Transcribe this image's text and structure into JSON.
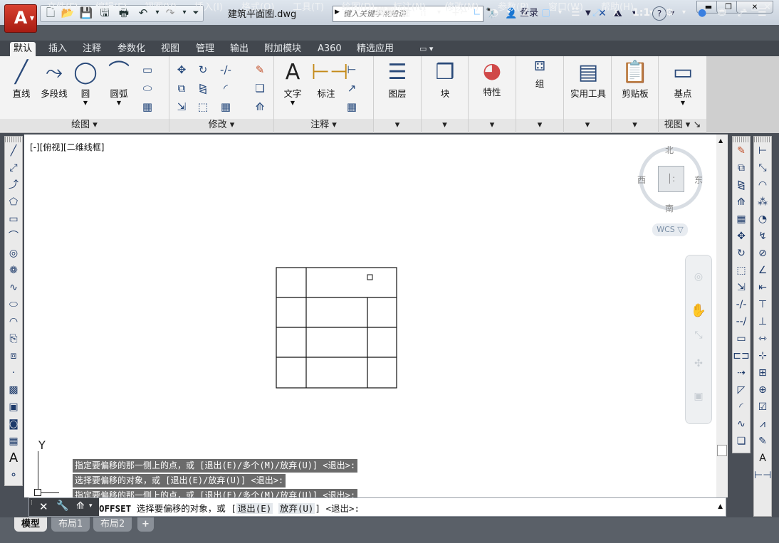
{
  "app": {
    "logo": "A",
    "doc_title": "建筑平面图.dwg",
    "login": "登录"
  },
  "search": {
    "placeholder": "键入关键字或短语"
  },
  "menus": [
    "文件(F)",
    "编辑(E)",
    "视图(V)",
    "插入(I)",
    "格式(O)",
    "工具(T)",
    "绘图(D)",
    "标注(N)",
    "修改(M)",
    "参数(P)",
    "窗口(W)",
    "帮助(H)"
  ],
  "tabs": [
    "默认",
    "插入",
    "注释",
    "参数化",
    "视图",
    "管理",
    "输出",
    "附加模块",
    "A360",
    "精选应用"
  ],
  "ribbon": {
    "draw": {
      "title": "绘图",
      "tools": [
        "直线",
        "多段线",
        "圆",
        "圆弧"
      ]
    },
    "modify": {
      "title": "修改"
    },
    "annot": {
      "title": "注释",
      "tools": [
        "文字",
        "标注"
      ]
    },
    "layer": "图层",
    "block": "块",
    "props": "特性",
    "group": "组",
    "util": "实用工具",
    "clip": "剪贴板",
    "base": "基点",
    "view": {
      "title": "视图"
    }
  },
  "viewport": {
    "label": "[-][俯视][二维线框]"
  },
  "viewcube": {
    "north": "北",
    "south": "南",
    "east": "东",
    "west": "西",
    "wcs": "WCS"
  },
  "ucs": {
    "y": "Y"
  },
  "command": {
    "history": [
      "指定要偏移的那一侧上的点，或 [退出(E)/多个(M)/放弃(U)] <退出>:",
      "选择要偏移的对象，或 [退出(E)/放弃(U)] <退出>:",
      "指定要偏移的那一侧上的点，或 [退出(E)/多个(M)/放弃(U)] <退出>:"
    ],
    "name": "OFFSET",
    "prompt": "选择要偏移的对象，或 [",
    "opt1": "退出(E)",
    "opt2": "放弃(U)",
    "tail": "] <退出>:"
  },
  "layouts": [
    "模型",
    "布局1",
    "布局2"
  ],
  "status": {
    "model": "模型",
    "scale": "1:1"
  }
}
